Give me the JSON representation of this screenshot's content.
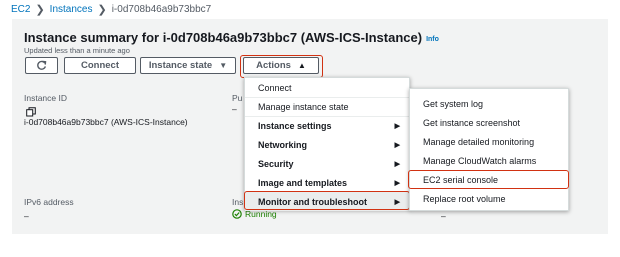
{
  "breadcrumb": {
    "items": [
      "EC2",
      "Instances",
      "i-0d708b46a9b73bbc7"
    ]
  },
  "header": {
    "title": "Instance summary for i-0d708b46a9b73bbc7 (AWS-ICS-Instance)",
    "info": "Info",
    "updated": "Updated less than a minute ago"
  },
  "toolbar": {
    "connect_label": "Connect",
    "instance_state_label": "Instance state",
    "actions_label": "Actions"
  },
  "details": {
    "instance_id_label": "Instance ID",
    "instance_id_value": "i-0d708b46a9b73bbc7 (AWS-ICS-Instance)",
    "col2_label_fragment": "Pu",
    "col2_value": "–",
    "ipv6_label": "IPv6 address",
    "ipv6_value": "–",
    "state_label_fragment": "Ins",
    "state_value": "Running",
    "right_value": "–"
  },
  "actions_menu": {
    "items": [
      {
        "label": "Connect",
        "group": false,
        "arrow": false
      },
      {
        "label": "Manage instance state",
        "group": false,
        "arrow": false
      },
      {
        "label": "Instance settings",
        "group": true,
        "arrow": true
      },
      {
        "label": "Networking",
        "group": true,
        "arrow": true
      },
      {
        "label": "Security",
        "group": true,
        "arrow": true
      },
      {
        "label": "Image and templates",
        "group": true,
        "arrow": true
      },
      {
        "label": "Monitor and troubleshoot",
        "group": true,
        "arrow": true,
        "selected": true
      }
    ]
  },
  "submenu": {
    "items": [
      {
        "label": "Get system log"
      },
      {
        "label": "Get instance screenshot"
      },
      {
        "label": "Manage detailed monitoring"
      },
      {
        "label": "Manage CloudWatch alarms"
      },
      {
        "label": "EC2 serial console",
        "highlighted": true
      },
      {
        "label": "Replace root volume"
      }
    ]
  },
  "colors": {
    "link": "#0073bb",
    "running": "#1d8102",
    "highlight_border": "#d13212",
    "panel": "#f2f3f3"
  },
  "icons": [
    "chevron-right-icon",
    "refresh-icon",
    "caret-down-icon",
    "caret-up-icon",
    "copy-icon",
    "check-circle-icon",
    "caret-right-icon"
  ]
}
